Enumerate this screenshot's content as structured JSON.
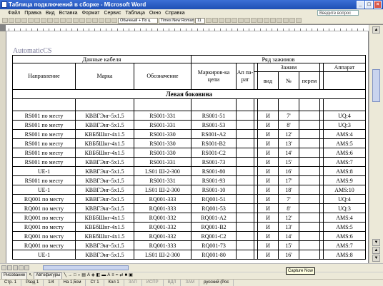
{
  "window": {
    "title": "Таблица подключений в сборке - Microsoft Word"
  },
  "menu": [
    "Файл",
    "Правка",
    "Вид",
    "Вставка",
    "Формат",
    "Сервис",
    "Таблица",
    "Окно",
    "Справка"
  ],
  "help_box": "Введите вопрос",
  "toolbar": {
    "style": "Обычный + По ц",
    "font": "Times New Roman",
    "size": "11"
  },
  "document": {
    "label": "AutomaticCS",
    "table": {
      "header_cable": "Данные кабеля",
      "header_terminal_row": "Ряд зажимов",
      "col_direction": "Направление",
      "col_brand": "Марка",
      "col_designation": "Обозначение",
      "col_marking": "Маркиров-ка цепи",
      "col_apparatus_short": "Ап па-рат",
      "col_terminal": "Зажим",
      "col_type": "вид",
      "col_number": "№",
      "col_jumper": "перем",
      "col_apparatus": "Аппарат",
      "section": "Левая боковина",
      "rows": [
        [
          "RS001 по месту",
          "КВВГЭнг-5х1.5",
          "RS001-331",
          "RS001-51",
          "И",
          "7'",
          "UQ:4"
        ],
        [
          "RS001 по месту",
          "КВВГЭнг-5х1.5",
          "RS001-331",
          "RS001-53",
          "И",
          "8'",
          "UQ:3"
        ],
        [
          "RS001 по месту",
          "КВБбШнг-4х1.5",
          "RS001-330",
          "RS001-A2",
          "И",
          "12'",
          "AMS:4"
        ],
        [
          "RS001 по месту",
          "КВБбШнг-4х1.5",
          "RS001-330",
          "RS001-B2",
          "И",
          "13'",
          "AMS:5"
        ],
        [
          "RS001 по месту",
          "КВБбШнг-4х1.5",
          "RS001-330",
          "RS001-C2",
          "И",
          "14'",
          "AMS:6"
        ],
        [
          "RS001 по месту",
          "КВВГЭнг-5х1.5",
          "RS001-331",
          "RS001-73",
          "И",
          "15'",
          "AMS:7"
        ],
        [
          "UE-1",
          "КВВГЭнг-5х1.5",
          "LS01 Ш-2-300",
          "RS001-80",
          "И",
          "16'",
          "AMS:8"
        ],
        [
          "RS001 по месту",
          "КВВГЭнг-5х1.5",
          "RS001-331",
          "RS001-93",
          "И",
          "17'",
          "AMS:9"
        ],
        [
          "UE-1",
          "КВВГЭнг-5х1.5",
          "LS01 Ш-2-300",
          "RS001-10",
          "И",
          "18'",
          "AMS:10"
        ],
        [
          "RQ001 по месту",
          "КВВГЭнг-5х1.5",
          "RQ001-333",
          "RQ001-51",
          "И",
          "7'",
          "UQ:4"
        ],
        [
          "RQ001 по месту",
          "КВВГЭнг-5х1.5",
          "RQ001-333",
          "RQ001-53",
          "И",
          "8'",
          "UQ:3"
        ],
        [
          "RQ001 по месту",
          "КВБбШнг-4х1.5",
          "RQ001-332",
          "RQ001-A2",
          "И",
          "12'",
          "AMS:4"
        ],
        [
          "RQ001 по месту",
          "КВБбШнг-4х1.5",
          "RQ001-332",
          "RQ001-B2",
          "И",
          "13'",
          "AMS:5"
        ],
        [
          "RQ001 по месту",
          "КВБбШнг-4х1.5",
          "RQ001-332",
          "RQ001-C2",
          "И",
          "14'",
          "AMS:6"
        ],
        [
          "RQ001 по месту",
          "КВВГЭнг-5х1.5",
          "RQ001-333",
          "RQ001-73",
          "И",
          "15'",
          "AMS:7"
        ],
        [
          "UE-1",
          "КВВГЭнг-5х1.5",
          "LS01 Ш-2-300",
          "RQ001-80",
          "И",
          "16'",
          "AMS:8"
        ]
      ]
    }
  },
  "drawing_toolbar": {
    "draw": "Рисование",
    "autoshapes": "Автофигуры"
  },
  "tooltip": "Capture Now",
  "status": [
    "Стр. 1",
    "Разд 1",
    "1/4",
    "На 1,5см",
    "Ст 1",
    "Кол 1",
    "ЗАП",
    "ИСПР",
    "ВДЛ",
    "ЗАМ",
    "русский (Рос"
  ]
}
